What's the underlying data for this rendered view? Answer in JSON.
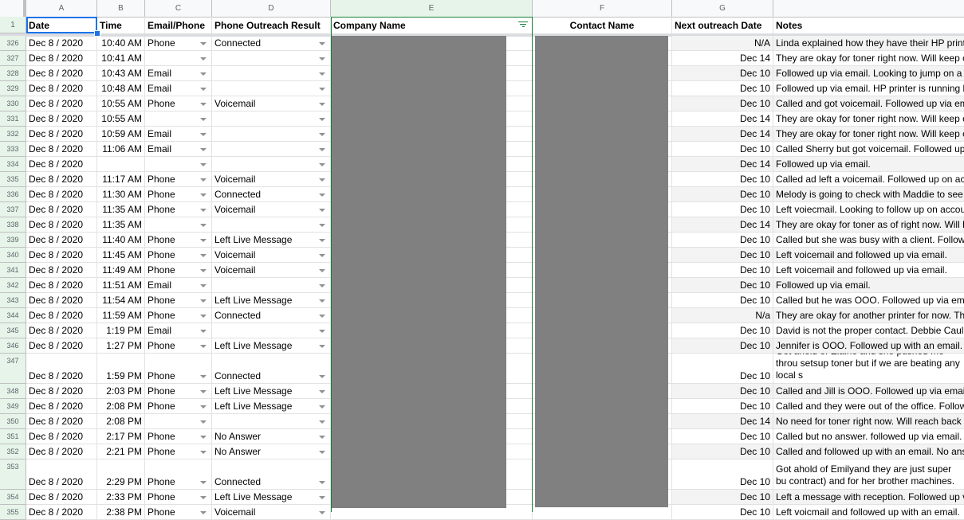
{
  "column_letters": [
    "A",
    "B",
    "C",
    "D",
    "E",
    "F",
    "G",
    ""
  ],
  "selected_column": "E",
  "header_row": {
    "row_number": "1",
    "cells": [
      "Date",
      "Time",
      "Email/Phone",
      "Phone Outreach Result",
      "Company Name",
      "Contact Name",
      "Next outreach Date",
      "Notes"
    ]
  },
  "rows": [
    {
      "n": "326",
      "date": "Dec 8 / 2020",
      "time": "10:40 AM",
      "method": "Phone",
      "result": "Connected",
      "next": "N/A",
      "notes": "Linda explained how they have their HP print"
    },
    {
      "n": "327",
      "date": "Dec 8 / 2020",
      "time": "10:41 AM",
      "method": "",
      "result": "",
      "next": "Dec 14",
      "notes": "They are okay for toner right now. Will keep c"
    },
    {
      "n": "328",
      "date": "Dec 8 / 2020",
      "time": "10:43 AM",
      "method": "Email",
      "result": "",
      "next": "Dec 10",
      "notes": "Followed up via email. Looking to jump on a"
    },
    {
      "n": "329",
      "date": "Dec 8 / 2020",
      "time": "10:48 AM",
      "method": "Email",
      "result": "",
      "next": "Dec 10",
      "notes": "Followed up via email. HP printer is running l"
    },
    {
      "n": "330",
      "date": "Dec 8 / 2020",
      "time": "10:55 AM",
      "method": "Phone",
      "result": "Voicemail",
      "next": "Dec 10",
      "notes": "Called and got voicemail. Followed up via em"
    },
    {
      "n": "331",
      "date": "Dec 8 / 2020",
      "time": "10:55 AM",
      "method": "",
      "result": "",
      "next": "Dec 14",
      "notes": "They are okay for toner right now. Will keep c"
    },
    {
      "n": "332",
      "date": "Dec 8 / 2020",
      "time": "10:59 AM",
      "method": "Email",
      "result": "",
      "next": "Dec 14",
      "notes": "They are okay for toner right now. Will keep c"
    },
    {
      "n": "333",
      "date": "Dec 8 / 2020",
      "time": "11:06 AM",
      "method": "Email",
      "result": "",
      "next": "Dec 10",
      "notes": "Called Sherry but got voicemail. Followed up"
    },
    {
      "n": "334",
      "date": "Dec 8 / 2020",
      "time": "",
      "method": "",
      "result": "",
      "next": "Dec 14",
      "notes": "Followed up via email."
    },
    {
      "n": "335",
      "date": "Dec 8 / 2020",
      "time": "11:17 AM",
      "method": "Phone",
      "result": "Voicemail",
      "next": "Dec 10",
      "notes": "Called ad left a voicemail. Followed up on ac"
    },
    {
      "n": "336",
      "date": "Dec 8 / 2020",
      "time": "11:30 AM",
      "method": "Phone",
      "result": "Connected",
      "next": "Dec 10",
      "notes": "Melody is going to check with Maddie to see"
    },
    {
      "n": "337",
      "date": "Dec 8 / 2020",
      "time": "11:35 AM",
      "method": "Phone",
      "result": "Voicemail",
      "next": "Dec 10",
      "notes": "Left voiecmail. Looking to follow up on accou"
    },
    {
      "n": "338",
      "date": "Dec 8 / 2020",
      "time": "11:35 AM",
      "method": "",
      "result": "",
      "next": "Dec 14",
      "notes": "They are okay for toner as of right now. Will l"
    },
    {
      "n": "339",
      "date": "Dec 8 / 2020",
      "time": "11:40 AM",
      "method": "Phone",
      "result": "Left Live Message",
      "next": "Dec 10",
      "notes": "Called but she was busy with a client. Follow"
    },
    {
      "n": "340",
      "date": "Dec 8 / 2020",
      "time": "11:45 AM",
      "method": "Phone",
      "result": "Voicemail",
      "next": "Dec 10",
      "notes": "Left voicemail and followed up via email."
    },
    {
      "n": "341",
      "date": "Dec 8 / 2020",
      "time": "11:49 AM",
      "method": "Phone",
      "result": "Voicemail",
      "next": "Dec 10",
      "notes": "Left voicemail and followed up via email."
    },
    {
      "n": "342",
      "date": "Dec 8 / 2020",
      "time": "11:51 AM",
      "method": "Email",
      "result": "",
      "next": "Dec 10",
      "notes": "Followed up via email."
    },
    {
      "n": "343",
      "date": "Dec 8 / 2020",
      "time": "11:54 AM",
      "method": "Phone",
      "result": "Left Live Message",
      "next": "Dec 10",
      "notes": "Called but he was OOO. Followed up via em"
    },
    {
      "n": "344",
      "date": "Dec 8 / 2020",
      "time": "11:59 AM",
      "method": "Phone",
      "result": "Connected",
      "next": "N/a",
      "notes": "They are okay for another printer for now. Th"
    },
    {
      "n": "345",
      "date": "Dec 8 / 2020",
      "time": "1:19 PM",
      "method": "Email",
      "result": "",
      "next": "Dec 10",
      "notes": "David is not the proper contact. Debbie Caul"
    },
    {
      "n": "346",
      "date": "Dec 8 / 2020",
      "time": "1:27 PM",
      "method": "Phone",
      "result": "Left Live Message",
      "next": "Dec 10",
      "notes": "Jennifer is OOO. Followed up with an email."
    },
    {
      "n": "347",
      "date": "Dec 8 / 2020",
      "time": "1:59 PM",
      "method": "Phone",
      "result": "Connected",
      "next": "Dec 10",
      "notes": "Got ahold of Elaine and she pushed me throu setsup toner but if we are beating any local s",
      "tall": true
    },
    {
      "n": "348",
      "date": "Dec 8 / 2020",
      "time": "2:03 PM",
      "method": "Phone",
      "result": "Left Live Message",
      "next": "Dec 10",
      "notes": "Called and Jill is OOO. Followed up via emai"
    },
    {
      "n": "349",
      "date": "Dec 8 / 2020",
      "time": "2:08 PM",
      "method": "Phone",
      "result": "Left Live Message",
      "next": "Dec 10",
      "notes": "Called and they were out of the office. Follow"
    },
    {
      "n": "350",
      "date": "Dec 8 / 2020",
      "time": "2:08 PM",
      "method": "",
      "result": "",
      "next": "Dec 14",
      "notes": "No need for toner right now. Will reach back"
    },
    {
      "n": "351",
      "date": "Dec 8 / 2020",
      "time": "2:17 PM",
      "method": "Phone",
      "result": "No Answer",
      "next": "Dec 10",
      "notes": "Called but no answer. followed up via email."
    },
    {
      "n": "352",
      "date": "Dec 8 / 2020",
      "time": "2:21 PM",
      "method": "Phone",
      "result": "No Answer",
      "next": "Dec 10",
      "notes": "Called and followed up with an email. No ans"
    },
    {
      "n": "353",
      "date": "Dec 8 / 2020",
      "time": "2:29 PM",
      "method": "Phone",
      "result": "Connected",
      "next": "Dec 10",
      "notes": "Got ahold of Emilyand they are just super bu contract) and for her brother machines.",
      "tall": true
    },
    {
      "n": "354",
      "date": "Dec 8 / 2020",
      "time": "2:33 PM",
      "method": "Phone",
      "result": "Left Live Message",
      "next": "Dec 10",
      "notes": "Left a message with reception. Followed up v"
    },
    {
      "n": "355",
      "date": "Dec 8 / 2020",
      "time": "2:38 PM",
      "method": "Phone",
      "result": "Voicemail",
      "next": "Dec 10",
      "notes": "Left voicmail and followed up with an email."
    }
  ],
  "redacted_columns": [
    "Company Name",
    "Contact Name"
  ],
  "colors": {
    "selection_blue": "#1a73e8",
    "filter_green": "#188038",
    "selected_header_bg": "#e6f4ea",
    "band_gray": "#f3f3f3",
    "redaction_gray": "#808080"
  }
}
